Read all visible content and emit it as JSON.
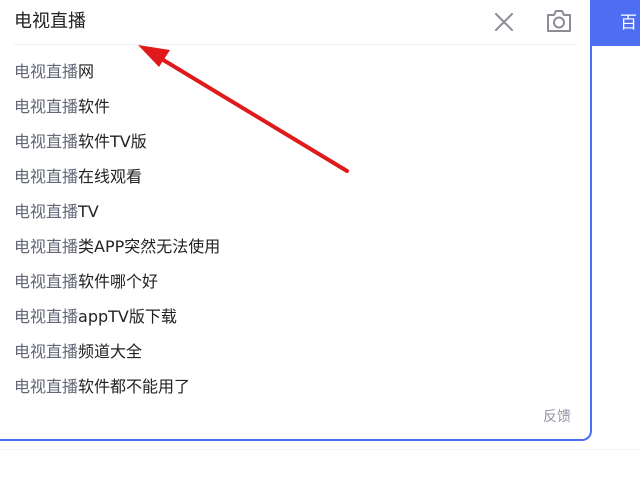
{
  "search": {
    "query": "电视直播",
    "button_label": "百"
  },
  "suggestions": [
    {
      "highlight": "电视直播",
      "rest": "网"
    },
    {
      "highlight": "电视直播",
      "rest": "软件"
    },
    {
      "highlight": "电视直播",
      "rest": "软件TV版"
    },
    {
      "highlight": "电视直播",
      "rest": "在线观看"
    },
    {
      "highlight": "电视直播",
      "rest": "TV"
    },
    {
      "highlight": "电视直播",
      "rest": "类APP突然无法使用"
    },
    {
      "highlight": "电视直播",
      "rest": "软件哪个好"
    },
    {
      "highlight": "电视直播",
      "rest": "appTV版下载"
    },
    {
      "highlight": "电视直播",
      "rest": "频道大全"
    },
    {
      "highlight": "电视直播",
      "rest": "软件都不能用了"
    }
  ],
  "footer": {
    "feedback_label": "反馈"
  },
  "colors": {
    "accent": "#4e6ef2",
    "arrow": "#e0191b",
    "highlight_text": "#626675",
    "text": "#222222"
  },
  "icons": {
    "clear": "close-icon",
    "camera": "camera-icon",
    "annotation": "red-arrow"
  }
}
